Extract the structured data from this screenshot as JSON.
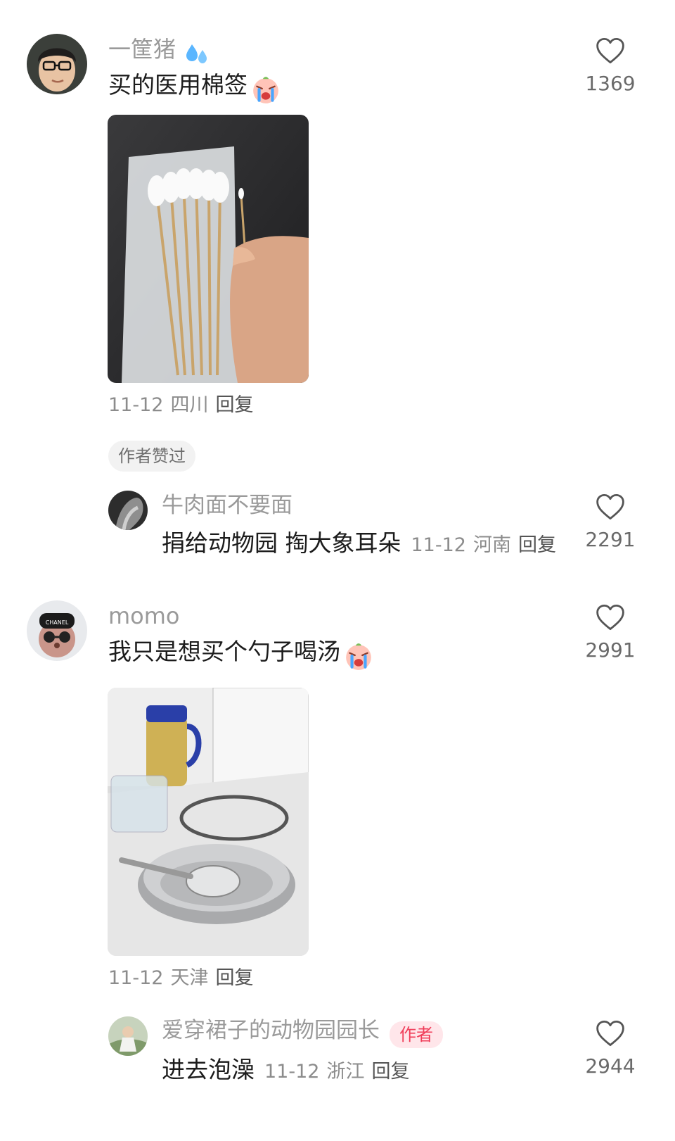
{
  "comments": [
    {
      "username": "一筐猪",
      "username_icon": "sweat-droplets-icon",
      "text": "买的医用棉签",
      "text_emoji": "crying-face-icon",
      "likes": "1369",
      "date": "11-12",
      "location": "四川",
      "reply_label": "回复",
      "author_liked_label": "作者赞过",
      "replies": [
        {
          "username": "牛肉面不要面",
          "text": "捐给动物园 掏大象耳朵",
          "date": "11-12",
          "location": "河南",
          "reply_label": "回复",
          "likes": "2291"
        }
      ]
    },
    {
      "username": "momo",
      "text": "我只是想买个勺子喝汤",
      "text_emoji": "crying-face-icon",
      "likes": "2991",
      "date": "11-12",
      "location": "天津",
      "reply_label": "回复",
      "replies": [
        {
          "username": "爱穿裙子的动物园园长",
          "author_tag": "作者",
          "text": "进去泡澡",
          "date": "11-12",
          "location": "浙江",
          "reply_label": "回复",
          "likes": "2944"
        }
      ]
    }
  ],
  "colors": {
    "accent_author": "#f03e5a",
    "meta_gray": "#8c8c8c",
    "name_gray": "#9a9a9a"
  }
}
